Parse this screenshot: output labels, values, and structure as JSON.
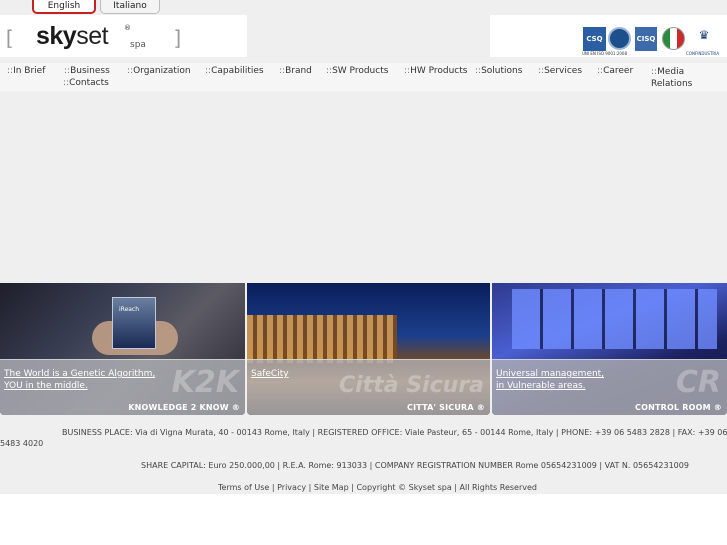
{
  "language": {
    "english": "English",
    "italian": "Italiano"
  },
  "logo": {
    "brand_bold": "sky",
    "brand_rest": "set",
    "registered": "®",
    "suffix": "spa",
    "bracket_left": "[",
    "bracket_right": "]"
  },
  "certifications": {
    "csq": "CSQ",
    "iqnet": "IQNET",
    "cisq": "CISQ",
    "flag": "italy-flag-icon",
    "confindustria": "confindustria-icon",
    "uni_caption": "UNI EN ISO 9001:2008",
    "conf_caption": "CONFINDUSTRIA"
  },
  "nav": {
    "prefix": "::",
    "items": [
      "In Brief",
      "Business",
      "Organization",
      "Capabilities",
      "Brand",
      "SW Products",
      "HW Products",
      "Solutions",
      "Services",
      "Career",
      "Media Relations",
      "Contacts"
    ]
  },
  "banners": [
    {
      "caption_line1": "The World is a Genetic Algorithm,",
      "caption_line2": "YOU in the middle.",
      "label": "KNOWLEDGE 2 KNOW ®",
      "mark": "K2K",
      "box_text": "iReach"
    },
    {
      "caption_line1": "SafeCity",
      "caption_line2": "",
      "label": "CITTA' SICURA ®",
      "mark": "Città Sicura"
    },
    {
      "caption_line1": "Universal management,",
      "caption_line2": "in Vulnerable areas.",
      "label": "CONTROL ROOM ®",
      "mark": "CR"
    }
  ],
  "footer": {
    "line1a": "BUSINESS PLACE: Via di Vigna Murata, 40 - 00143 Rome, Italy  |  REGISTERED OFFICE: Viale Pasteur, 65 - 00144 Rome, Italy  |  PHONE: +39 06 5483 2828  |  FAX: +39 06",
    "line1b": "5483 4020",
    "line2": "SHARE CAPITAL: Euro 250.000,00  |  R.E.A. Rome: 913033  |  COMPANY REGISTRATION NUMBER Rome 05654231009  |  VAT N. 05654231009",
    "links": [
      "Terms of Use",
      "Privacy",
      "Site Map",
      "Copyright © Skyset spa",
      "All Rights Reserved"
    ],
    "separator": "|"
  }
}
